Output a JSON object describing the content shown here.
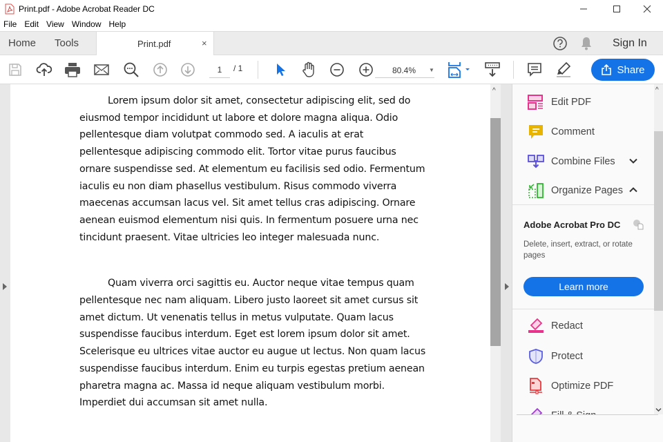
{
  "window": {
    "title": "Print.pdf - Adobe Acrobat Reader DC"
  },
  "menu": [
    "File",
    "Edit",
    "View",
    "Window",
    "Help"
  ],
  "tabs": {
    "home": "Home",
    "tools": "Tools",
    "document": "Print.pdf",
    "sign_in": "Sign In"
  },
  "toolbar": {
    "current_page": "1",
    "total_pages": "/ 1",
    "zoom_level": "80.4%",
    "share_label": "Share",
    "icons": [
      "save-icon",
      "upload-icon",
      "print-icon",
      "email-icon",
      "search-icon",
      "page-up-icon",
      "page-down-icon",
      "select-cursor-icon",
      "hand-icon",
      "zoom-out-icon",
      "zoom-in-icon",
      "fit-page-icon",
      "scroll-mode-icon",
      "comment-icon",
      "highlight-icon"
    ]
  },
  "document": {
    "paragraphs": [
      {
        "lines": [
          "Lorem ipsum dolor sit amet, consectetur adipiscing elit, sed do",
          "eiusmod tempor incididunt ut labore et dolore magna aliqua. Odio",
          "pellentesque diam volutpat commodo sed. A iaculis at erat",
          "pellentesque adipiscing commodo elit. Tortor vitae purus faucibus",
          "ornare suspendisse sed. At elementum eu facilisis sed odio. Fermentum",
          "iaculis eu non diam phasellus vestibulum. Risus commodo viverra",
          "maecenas accumsan lacus vel. Sit amet tellus cras adipiscing. Ornare",
          "aenean euismod elementum nisi quis. In fermentum posuere urna nec",
          "tincidunt praesent. Vitae ultricies leo integer malesuada nunc."
        ]
      },
      {
        "lines": [
          "Quam viverra orci sagittis eu. Auctor neque vitae tempus quam",
          "pellentesque nec nam aliquam. Libero justo laoreet sit amet cursus sit",
          "amet dictum. Ut venenatis tellus in metus vulputate. Quam lacus",
          "suspendisse faucibus interdum. Eget est lorem ipsum dolor sit amet.",
          "Scelerisque eu ultrices vitae auctor eu augue ut lectus. Non quam lacus",
          "suspendisse faucibus interdum. Enim eu turpis egestas pretium aenean",
          "pharetra magna ac. Massa id neque aliquam vestibulum morbi.",
          "Imperdiet dui accumsan sit amet nulla."
        ]
      }
    ]
  },
  "right_panel": {
    "tools_top": [
      {
        "label": "Edit PDF",
        "icon": "edit-pdf-icon",
        "color": "#e8338a"
      },
      {
        "label": "Comment",
        "icon": "comment-icon",
        "color": "#e8b400"
      },
      {
        "label": "Combine Files",
        "icon": "combine-files-icon",
        "color": "#5b4fdb",
        "chevron": "down"
      },
      {
        "label": "Organize Pages",
        "icon": "organize-pages-icon",
        "color": "#2eb82e",
        "chevron": "up"
      }
    ],
    "promo": {
      "title": "Adobe Acrobat Pro DC",
      "description": "Delete, insert, extract, or rotate pages",
      "button": "Learn more"
    },
    "tools_bottom": [
      {
        "label": "Redact",
        "icon": "redact-icon",
        "color": "#e8338a"
      },
      {
        "label": "Protect",
        "icon": "protect-icon",
        "color": "#5b5fe0"
      },
      {
        "label": "Optimize PDF",
        "icon": "optimize-pdf-icon",
        "color": "#e8383d"
      },
      {
        "label": "Fill & Sign",
        "icon": "fill-sign-icon",
        "color": "#a23bd6"
      }
    ]
  },
  "colors": {
    "accent": "#1473e6",
    "select_tool": "#1473e6"
  }
}
